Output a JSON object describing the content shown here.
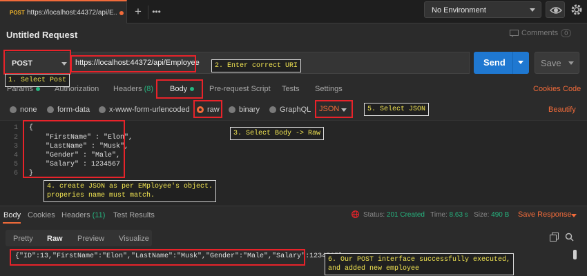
{
  "top_bar": {
    "tab": {
      "method": "POST",
      "url": "https://localhost:44372/api/E..."
    },
    "environment": "No Environment"
  },
  "request": {
    "title": "Untitled Request",
    "comments_label": "Comments",
    "comments_count": "0",
    "method": "POST",
    "url": "https://localhost:44372/api/Employee",
    "send_label": "Send",
    "save_label": "Save"
  },
  "request_tabs": {
    "params": "Params",
    "authorization": "Authorization",
    "headers": "Headers",
    "headers_count": "(8)",
    "body": "Body",
    "pre_request": "Pre-request Script",
    "tests": "Tests",
    "settings": "Settings",
    "cookies": "Cookies",
    "code": "Code"
  },
  "body_types": {
    "none": "none",
    "form_data": "form-data",
    "urlencoded": "x-www-form-urlencoded",
    "raw": "raw",
    "binary": "binary",
    "graphql": "GraphQL",
    "format": "JSON",
    "beautify": "Beautify"
  },
  "editor": {
    "line_numbers": [
      "1",
      "2",
      "3",
      "4",
      "5",
      "6"
    ],
    "lines": [
      "{",
      "    \"FirstName\" : \"Elon\",",
      "    \"LastName\" : \"Musk\",",
      "    \"Gender\" : \"Male\",",
      "    \"Salary\" : 1234567",
      "}"
    ]
  },
  "response": {
    "tabs": {
      "body": "Body",
      "cookies": "Cookies",
      "headers": "Headers",
      "headers_count": "(11)",
      "test_results": "Test Results"
    },
    "status_label": "Status:",
    "status_value": "201 Created",
    "time_label": "Time:",
    "time_value": "8.63 s",
    "size_label": "Size:",
    "size_value": "490 B",
    "save_response": "Save Response",
    "view_tabs": {
      "pretty": "Pretty",
      "raw": "Raw",
      "preview": "Preview",
      "visualize": "Visualize"
    },
    "body_text": "{\"ID\":13,\"FirstName\":\"Elon\",\"LastName\":\"Musk\",\"Gender\":\"Male\",\"Salary\":1234567}"
  },
  "annotations": {
    "step1": "1. Select Post",
    "step2": "2. Enter correct URI",
    "step3": "3. Select Body -> Raw",
    "step4": "4. create JSON as per EMployee's object.\nproperies name must match.",
    "step5": "5. Select JSON",
    "step6": "6. Our POST interface successfully executed,\nand added new employee"
  },
  "colors": {
    "accent": "#f26b3a",
    "send_button": "#1f78d1",
    "success_green": "#26b47f",
    "annotation_red": "#e8232a",
    "annotation_text": "#f2e552"
  }
}
